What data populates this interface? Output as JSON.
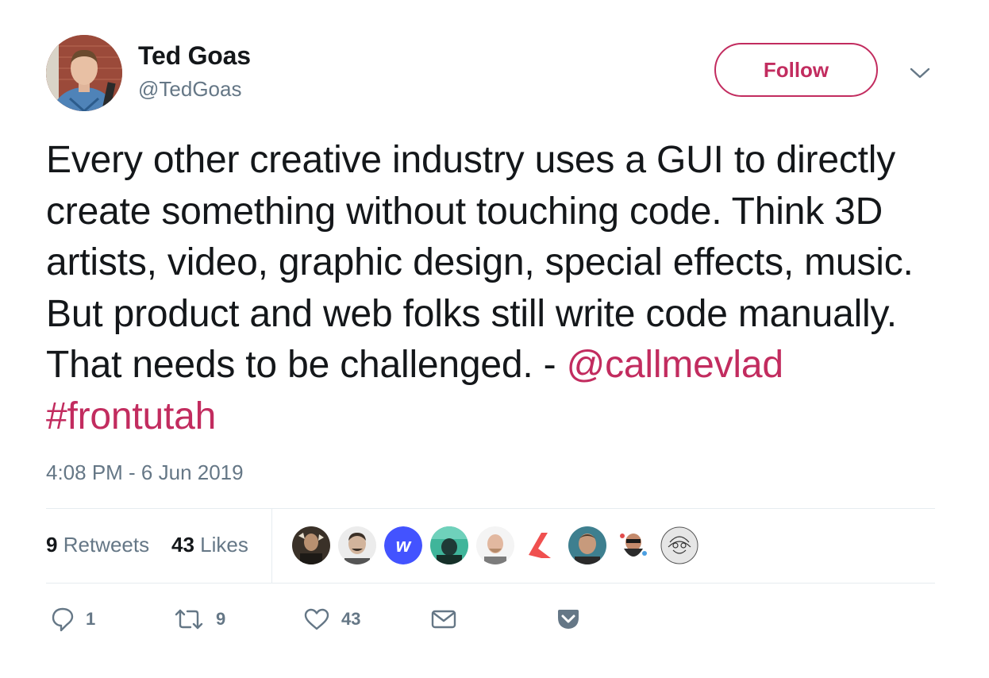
{
  "author": {
    "name": "Ted Goas",
    "handle": "@TedGoas",
    "avatar_icon": "profile-photo"
  },
  "follow_button": {
    "label": "Follow"
  },
  "menu_icon": "chevron-down-icon",
  "tweet": {
    "text": "Every other creative industry uses a GUI to directly create something without touching code. Think 3D artists, video, graphic design, special effects, music. But product and web folks still write code manually. That needs to be challenged. -",
    "mention": "@callmevlad",
    "hashtag": "#frontutah",
    "timestamp": "4:08 PM - 6 Jun 2019"
  },
  "stats": {
    "retweets_count": "9",
    "retweets_label": "Retweets",
    "likes_count": "43",
    "likes_label": "Likes"
  },
  "likers": [
    "liker-1",
    "liker-2",
    "webflow-logo",
    "liker-4",
    "liker-5",
    "liker-6",
    "liker-7",
    "liker-8",
    "liker-9"
  ],
  "actions": {
    "reply_count": "1",
    "retweet_count": "9",
    "like_count": "43"
  },
  "colors": {
    "accent": "#c22c5f",
    "secondary_text": "#657786",
    "primary_text": "#14171a",
    "divider": "#e6ecf0"
  }
}
